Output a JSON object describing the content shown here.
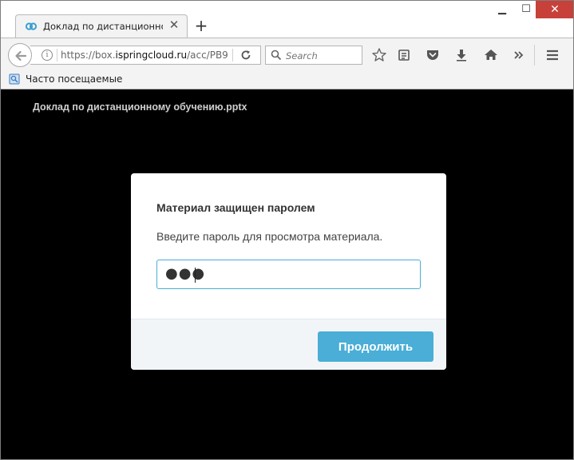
{
  "browser": {
    "tab": {
      "title": "Доклад по дистанционно..."
    },
    "address": {
      "prefix": "https://box.",
      "domain": "ispringcloud.ru",
      "path": "/acc/PB9"
    },
    "search": {
      "placeholder": "Search"
    },
    "bookmarks": {
      "item_label": "Часто посещаемые"
    }
  },
  "page": {
    "document_title": "Доклад по дистанционному обучению.pptx",
    "dialog": {
      "title": "Материал защищен паролем",
      "message": "Введите пароль для просмотра материала.",
      "password_value": "●●●",
      "continue_label": "Продолжить"
    }
  },
  "colors": {
    "accent": "#4aaed6",
    "close_button": "#c7413a",
    "page_background": "#000000"
  }
}
